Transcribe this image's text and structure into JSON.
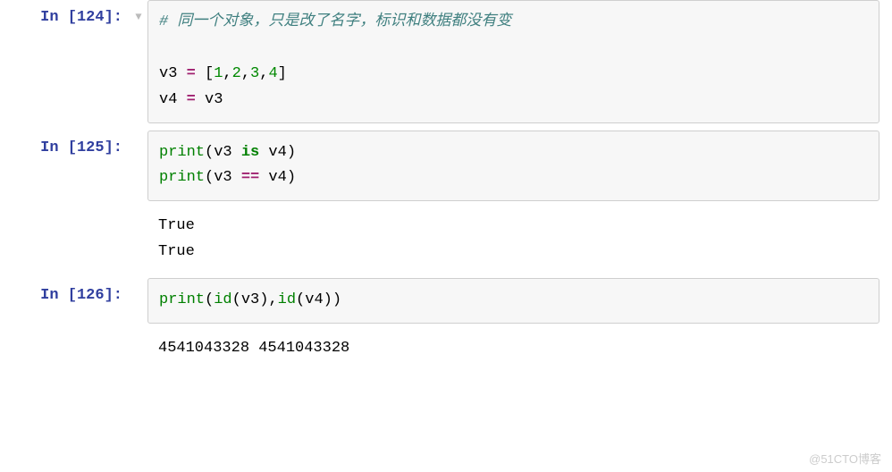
{
  "cells": [
    {
      "prompt": "In [124]:",
      "has_collapser": true,
      "code": {
        "comment": "# 同一个对象，只是改了名字，标识和数据都没有变",
        "line2_name_left": "v3 ",
        "line2_assign": "=",
        "line2_bracket_open": " [",
        "line2_n1": "1",
        "line2_c1": ",",
        "line2_n2": "2",
        "line2_c2": ",",
        "line2_n3": "3",
        "line2_c3": ",",
        "line2_n4": "4",
        "line2_bracket_close": "]",
        "line3_left": "v4 ",
        "line3_assign": "=",
        "line3_right": " v3"
      }
    },
    {
      "prompt": "In [125]:",
      "code": {
        "print": "print",
        "open": "(",
        "v3": "v3 ",
        "is": "is",
        "v4": " v4",
        "close": ")",
        "eq": "==",
        "v3b": "v3 ",
        "v4b": " v4"
      },
      "output": "True\nTrue"
    },
    {
      "prompt": "In [126]:",
      "code": {
        "print": "print",
        "open": "(",
        "id": "id",
        "v3": "v3",
        "comma": ",",
        "v4": "v4",
        "close": ")"
      },
      "output": "4541043328 4541043328"
    }
  ],
  "watermark": "@51CTO博客"
}
